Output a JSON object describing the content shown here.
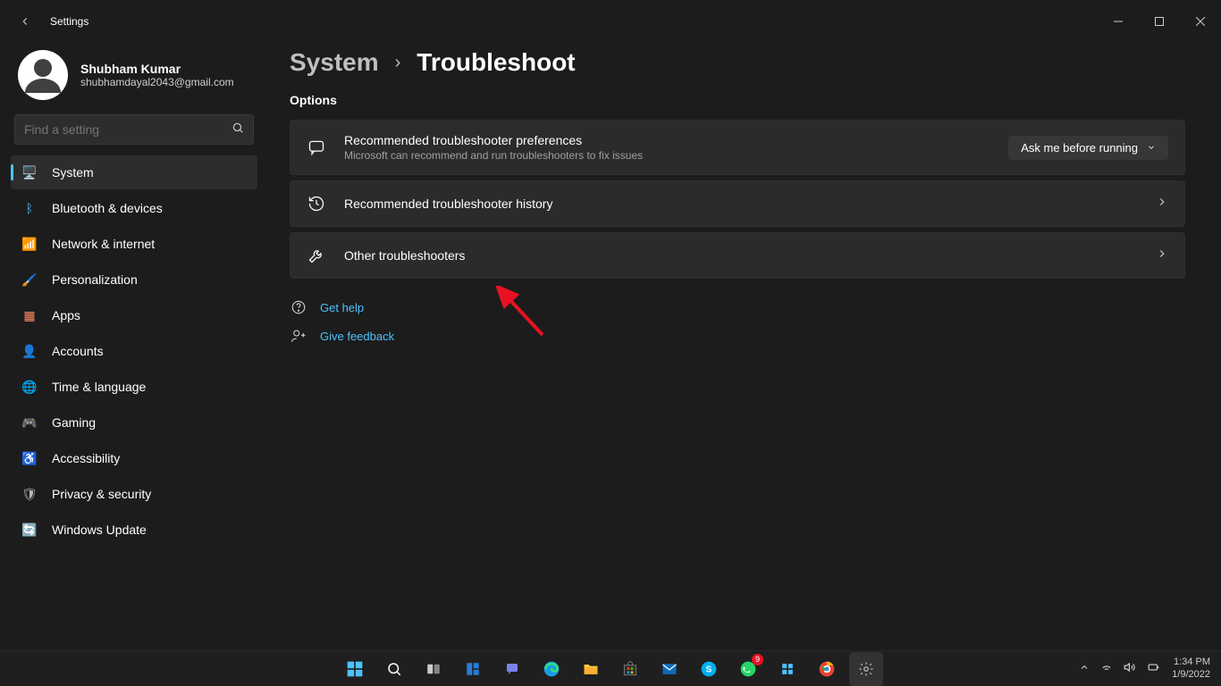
{
  "window": {
    "title": "Settings"
  },
  "profile": {
    "name": "Shubham Kumar",
    "email": "shubhamdayal2043@gmail.com"
  },
  "search": {
    "placeholder": "Find a setting"
  },
  "sidebar": {
    "items": [
      {
        "label": "System",
        "icon": "🖥️",
        "active": true
      },
      {
        "label": "Bluetooth & devices",
        "icon": "ᛒ"
      },
      {
        "label": "Network & internet",
        "icon": "📶"
      },
      {
        "label": "Personalization",
        "icon": "🖌️"
      },
      {
        "label": "Apps",
        "icon": "▦"
      },
      {
        "label": "Accounts",
        "icon": "👤"
      },
      {
        "label": "Time & language",
        "icon": "🌐"
      },
      {
        "label": "Gaming",
        "icon": "🎮"
      },
      {
        "label": "Accessibility",
        "icon": "♿"
      },
      {
        "label": "Privacy & security",
        "icon": "🛡"
      },
      {
        "label": "Windows Update",
        "icon": "🔄"
      }
    ]
  },
  "breadcrumb": {
    "level1": "System",
    "level2": "Troubleshoot"
  },
  "section_options_label": "Options",
  "cards": {
    "pref": {
      "title": "Recommended troubleshooter preferences",
      "subtitle": "Microsoft can recommend and run troubleshooters to fix issues",
      "select_value": "Ask me before running"
    },
    "history": {
      "title": "Recommended troubleshooter history"
    },
    "other": {
      "title": "Other troubleshooters"
    }
  },
  "links": {
    "help": "Get help",
    "feedback": "Give feedback"
  },
  "taskbar": {
    "time": "1:34 PM",
    "date": "1/9/2022"
  }
}
